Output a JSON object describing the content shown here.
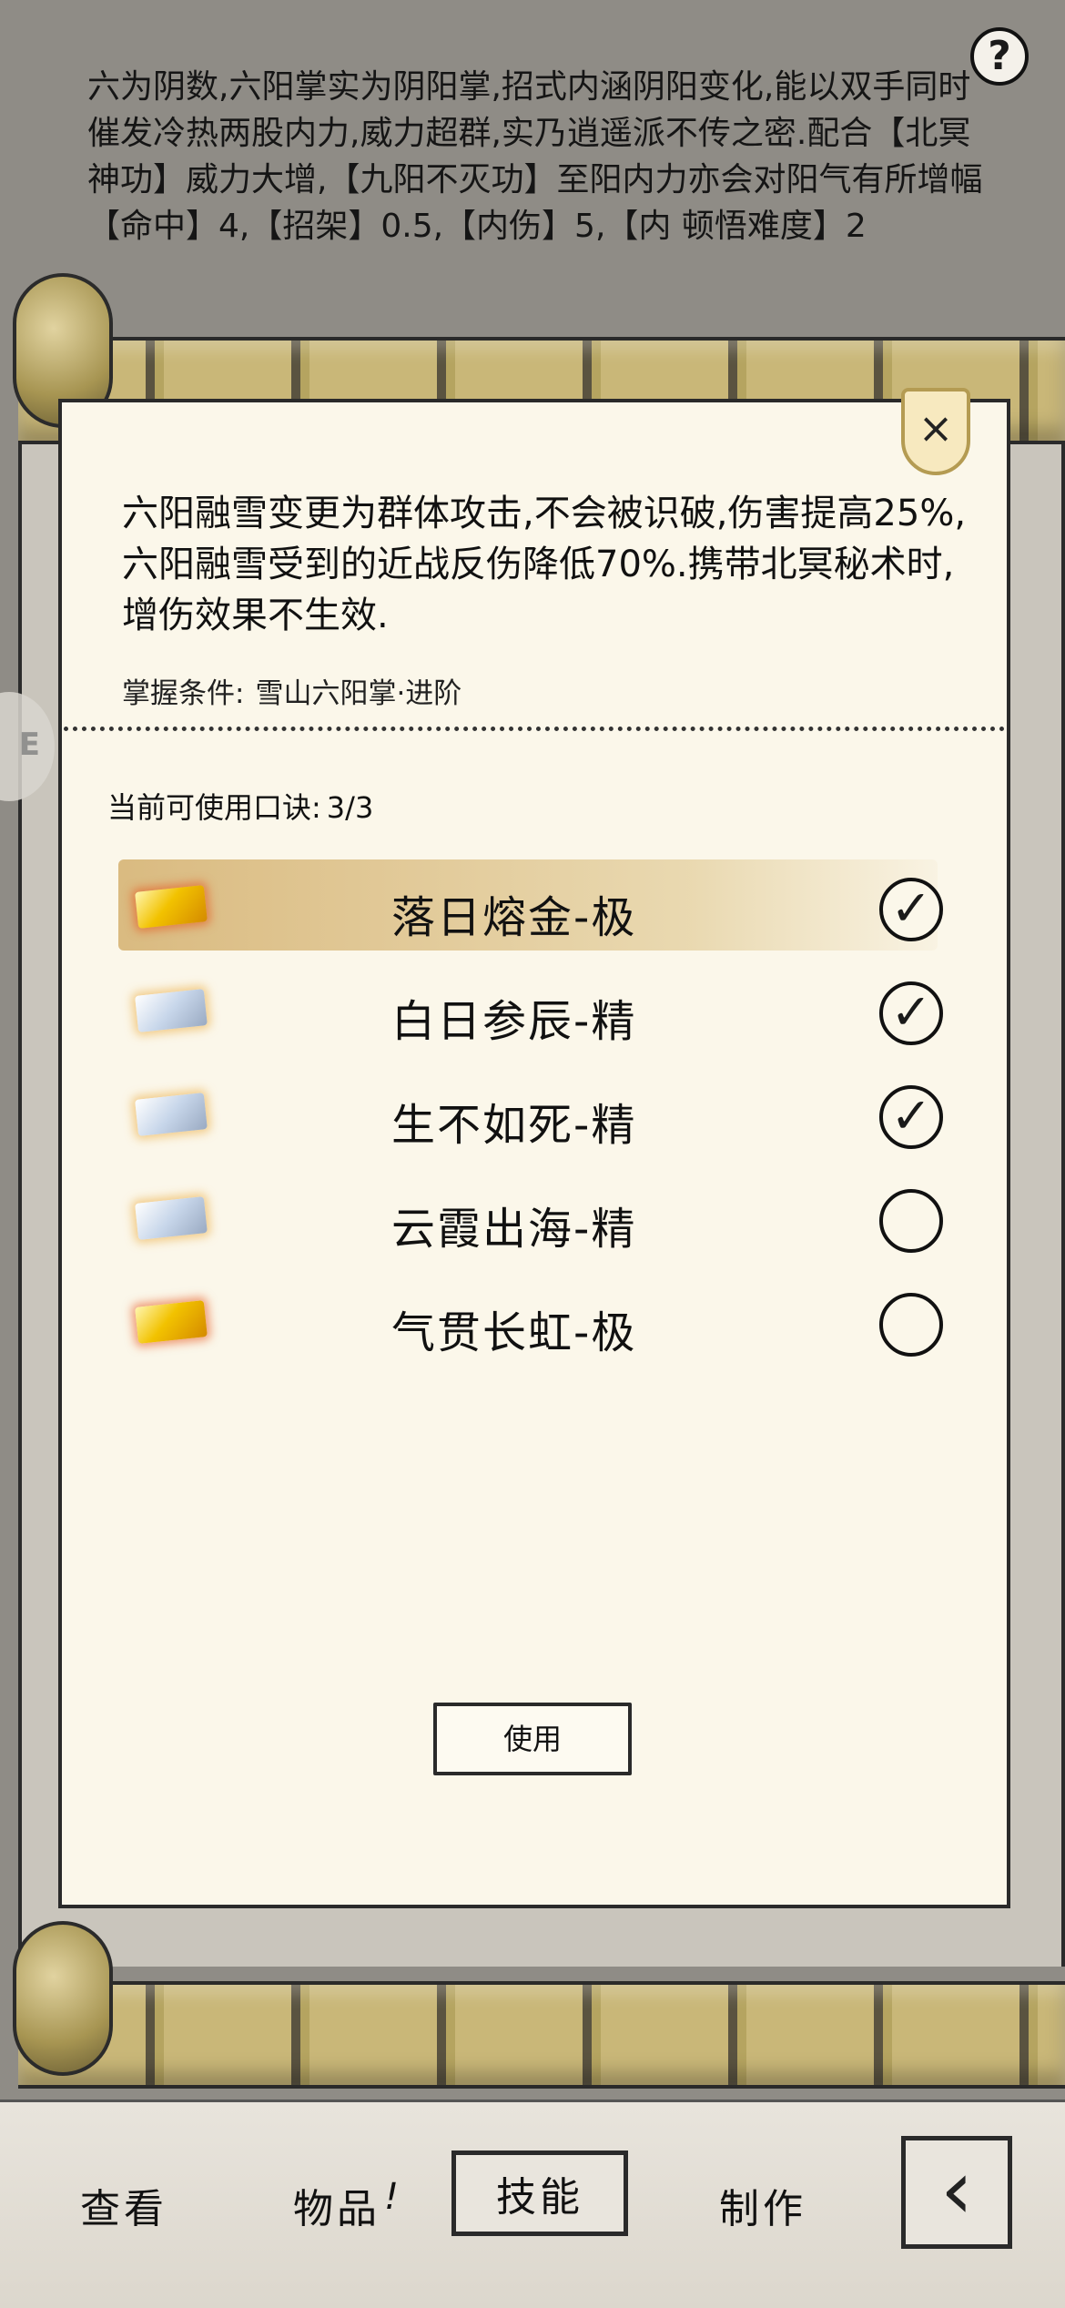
{
  "background_text": "六为阴数,六阳掌实为阴阳掌,招式内涵阴阳变化,能以双手同时催发冷热两股内力,威力超群,实乃逍遥派不传之密.配合【北冥神功】威力大增,【九阳不灭功】至阳内力亦会对阳气有所增幅 【命中】4,【招架】0.5,【内伤】5,【内 顿悟难度】2",
  "help_label": "?",
  "dialog": {
    "close_label": "×",
    "description": "六阳融雪变更为群体攻击,不会被识破,伤害提高25%,六阳融雪受到的近战反伤降低70%.携带北冥秘术时,增伤效果不生效.",
    "requirement_label": "掌握条件:",
    "requirement_value": "雪山六阳掌·进阶",
    "count_label": "当前可使用口诀:",
    "count_value": "3/3",
    "items": [
      {
        "name": "落日熔金-极",
        "token": "gold",
        "checked": true,
        "selected": true
      },
      {
        "name": "白日参辰-精",
        "token": "silver",
        "checked": true,
        "selected": false
      },
      {
        "name": "生不如死-精",
        "token": "silver",
        "checked": true,
        "selected": false
      },
      {
        "name": "云霞出海-精",
        "token": "silver",
        "checked": false,
        "selected": false
      },
      {
        "name": "气贯长虹-极",
        "token": "gold",
        "checked": false,
        "selected": false
      }
    ],
    "use_button": "使用"
  },
  "tabs": {
    "view": "查看",
    "items": "物品",
    "items_badge": "!",
    "skills": "技能",
    "craft": "制作"
  },
  "colors": {
    "panel": "#fbf7ea",
    "selected_highlight": "#d4b06e",
    "gold_token": "#f2c200",
    "silver_token": "#c7d6ea"
  }
}
